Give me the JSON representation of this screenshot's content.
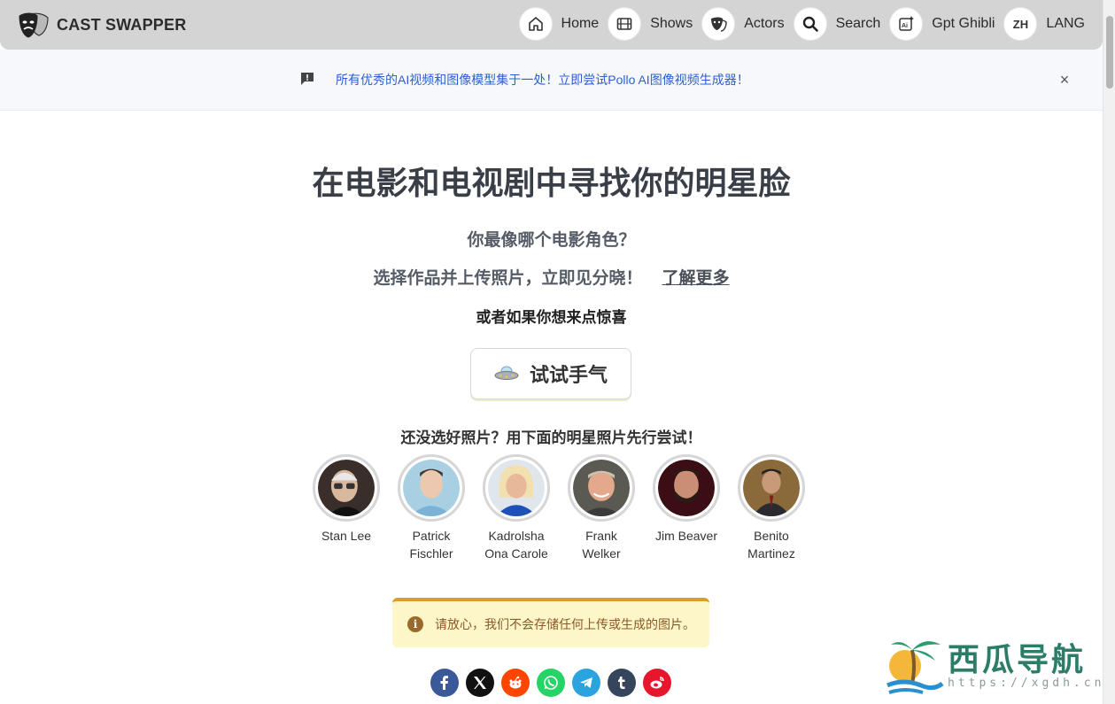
{
  "header": {
    "brand": "CAST SWAPPER",
    "nav": [
      {
        "label": "Home",
        "icon": "home-icon"
      },
      {
        "label": "Shows",
        "icon": "film-icon"
      },
      {
        "label": "Actors",
        "icon": "mask-icon"
      },
      {
        "label": "Search",
        "icon": "search-icon"
      },
      {
        "label": "Gpt Ghibli",
        "icon": "ai-image-icon"
      },
      {
        "label": "LANG",
        "icon": "language-icon",
        "badge": "ZH"
      }
    ]
  },
  "announcement": {
    "text": "所有优秀的AI视频和图像模型集于一处！立即尝试Pollo AI图像视频生成器！",
    "close": "×"
  },
  "main": {
    "title": "在电影和电视剧中寻找你的明星脸",
    "question": "你最像哪个电影角色？",
    "instruction": "选择作品并上传照片，立即见分晓！",
    "learn_more": "了解更多",
    "surprise": "或者如果你想来点惊喜",
    "try_button": "试试手气",
    "celebs_title": "还没选好照片？用下面的明星照片先行尝试！",
    "celebs": [
      {
        "name": "Stan Lee"
      },
      {
        "name": "Patrick Fischler"
      },
      {
        "name": "Kadrolsha Ona Carole"
      },
      {
        "name": "Frank Welker"
      },
      {
        "name": "Jim Beaver"
      },
      {
        "name": "Benito Martinez"
      }
    ],
    "notice": "请放心，我们不会存储任何上传或生成的图片。"
  },
  "share": [
    {
      "name": "facebook",
      "color": "#3b5998"
    },
    {
      "name": "x",
      "color": "#111111"
    },
    {
      "name": "reddit",
      "color": "#ff4500"
    },
    {
      "name": "whatsapp",
      "color": "#25d366"
    },
    {
      "name": "telegram",
      "color": "#2aa3de"
    },
    {
      "name": "tumblr",
      "color": "#35465c"
    },
    {
      "name": "weibo",
      "color": "#e6162d"
    }
  ],
  "watermark": {
    "text": "西瓜导航",
    "url": "https://xgdh.cn"
  }
}
